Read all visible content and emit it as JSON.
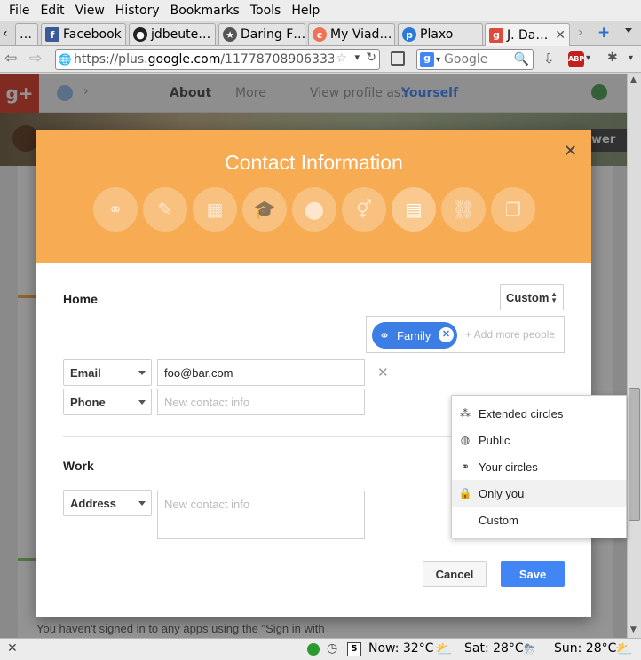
{
  "menubar": {
    "items": [
      "File",
      "Edit",
      "View",
      "History",
      "Bookmarks",
      "Tools",
      "Help"
    ]
  },
  "tabs": [
    {
      "label": "…"
    },
    {
      "label": "Facebook"
    },
    {
      "label": "jdbeute…"
    },
    {
      "label": "Daring F…"
    },
    {
      "label": "My Viad…"
    },
    {
      "label": "Plaxo"
    },
    {
      "label": "J. Da…"
    }
  ],
  "navbar": {
    "url_prefix": "https://plus.",
    "url_domain": "google.com",
    "url_rest": "/117787089063338",
    "search_placeholder": "Google"
  },
  "gplus": {
    "logo": "g+",
    "about": "About",
    "more": "More",
    "view_profile_as": "View profile as:",
    "viewer": "Yourself",
    "follow_partial": "wer"
  },
  "modal": {
    "title": "Contact Information",
    "close": "✕",
    "home_label": "Home",
    "home_visibility": "Custom",
    "chip_label": "Family",
    "add_people_placeholder": "+ Add more people",
    "rows_home": [
      {
        "type": "Email",
        "value": "foo@bar.com",
        "placeholder": ""
      },
      {
        "type": "Phone",
        "value": "",
        "placeholder": "New contact info"
      }
    ],
    "remove_icon": "✕",
    "work_label": "Work",
    "rows_work": [
      {
        "type": "Address",
        "value": "",
        "placeholder": "New contact info"
      }
    ],
    "cancel": "Cancel",
    "save": "Save"
  },
  "dropdown": {
    "items": [
      {
        "label": "Extended circles",
        "icon": "extended-circles-icon"
      },
      {
        "label": "Public",
        "icon": "globe-icon"
      },
      {
        "label": "Your circles",
        "icon": "circles-icon"
      },
      {
        "label": "Only you",
        "icon": "lock-icon"
      },
      {
        "label": "Custom",
        "icon": ""
      }
    ]
  },
  "background_text": "You haven't signed in to any apps using the \"Sign in with",
  "statusbar": {
    "now": "Now: 32°C",
    "sat": "Sat: 28°C",
    "sun": "Sun: 28°C",
    "calendar_day": "5"
  },
  "colors": {
    "modal_header": "#f7ac54",
    "primary_blue": "#4285f4",
    "chip_blue": "#3d7ee6"
  }
}
